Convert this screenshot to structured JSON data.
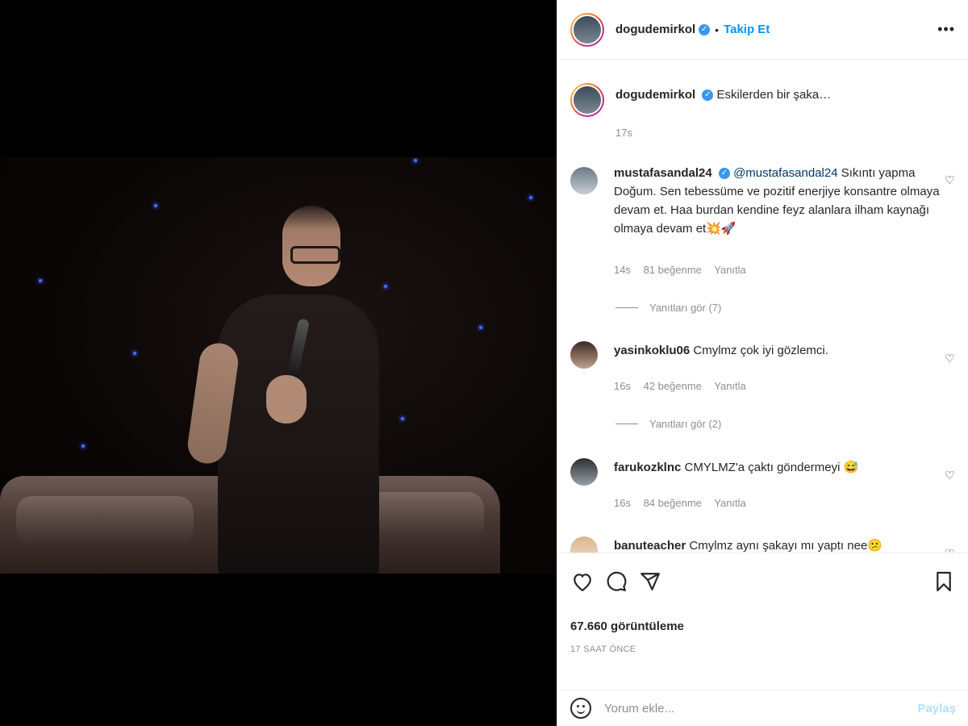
{
  "post": {
    "username": "dogudemirkol",
    "follow_label": "Takip Et",
    "dot": "•",
    "more_label": "•••"
  },
  "caption": {
    "username": "dogudemirkol",
    "text": "Eskilerden bir şaka…",
    "time": "17s"
  },
  "comments": [
    {
      "username": "mustafasandal24",
      "mention": "@mustafasandal24",
      "text": " Sıkıntı yapma Doğum. Sen tebessüme ve pozitif enerjiye konsantre olmaya devam et. Haa burdan kendine feyz alanlara ilham kaynağı olmaya devam et💥🚀",
      "time": "14s",
      "likes": "81 beğenme",
      "reply": "Yanıtla",
      "view_replies": "Yanıtları gör (7)"
    },
    {
      "username": "yasinkoklu06",
      "text": "Cmylmz çok iyi gözlemci.",
      "time": "16s",
      "likes": "42 beğenme",
      "reply": "Yanıtla",
      "view_replies": "Yanıtları gör (2)"
    },
    {
      "username": "farukozklnc",
      "text": "CMYLMZ'a çaktı göndermeyi 😅",
      "time": "16s",
      "likes": "84 beğenme",
      "reply": "Yanıtla"
    },
    {
      "username": "banuteacher",
      "text": "Cmylmz aynı şakayı mı yaptı nee😕"
    }
  ],
  "stats": {
    "views": "67.660 görüntüleme",
    "posted": "17 SAAT ÖNCE"
  },
  "add_comment": {
    "placeholder": "Yorum ekle...",
    "share_label": "Paylaş"
  },
  "icons": {
    "like": "heart-icon",
    "comment": "comment-icon",
    "share": "paper-plane-icon",
    "save": "bookmark-icon",
    "emoji": "emoji-icon",
    "verified": "verified-badge-icon",
    "more": "more-options-icon"
  },
  "colors": {
    "accent": "#0095f6",
    "verified": "#3897f0",
    "muted": "#8e8e8e",
    "share_disabled": "#b2dffc"
  }
}
